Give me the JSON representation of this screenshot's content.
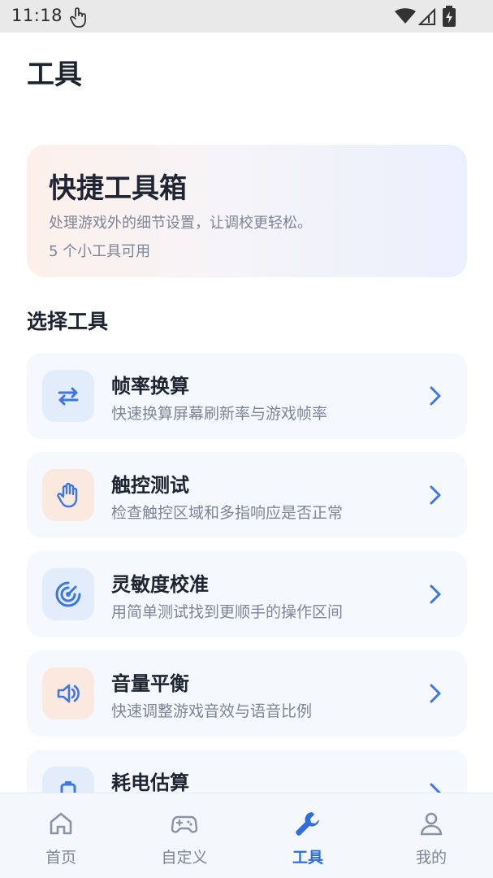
{
  "status_bar": {
    "time": "11:18",
    "icons": [
      "gesture-icon",
      "wifi-icon",
      "signal-icon",
      "battery-charging-icon"
    ]
  },
  "header": {
    "title": "工具"
  },
  "hero": {
    "title": "快捷工具箱",
    "subtitle": "处理游戏外的细节设置，让调校更轻松。",
    "count_text": "5 个小工具可用"
  },
  "section": {
    "title": "选择工具"
  },
  "tools": [
    {
      "title": "帧率换算",
      "description": "快速换算屏幕刷新率与游戏帧率",
      "icon": "swap-arrows-icon",
      "icon_bg": "blue"
    },
    {
      "title": "触控测试",
      "description": "检查触控区域和多指响应是否正常",
      "icon": "hand-icon",
      "icon_bg": "peach"
    },
    {
      "title": "灵敏度校准",
      "description": "用简单测试找到更顺手的操作区间",
      "icon": "target-icon",
      "icon_bg": "blue"
    },
    {
      "title": "音量平衡",
      "description": "快速调整游戏音效与语音比例",
      "icon": "speaker-icon",
      "icon_bg": "peach"
    },
    {
      "title": "耗电估算",
      "description": "",
      "icon": "battery-icon",
      "icon_bg": "blue"
    }
  ],
  "bottom_nav": {
    "items": [
      {
        "label": "首页",
        "icon": "home-icon",
        "active": false
      },
      {
        "label": "自定义",
        "icon": "gamepad-icon",
        "active": false
      },
      {
        "label": "工具",
        "icon": "wrench-icon",
        "active": true
      },
      {
        "label": "我的",
        "icon": "user-icon",
        "active": false
      }
    ]
  },
  "colors": {
    "accent": "#2f6ce0",
    "icon_blue": "#3c78e0",
    "icon_peach_fg": "#3c78e0",
    "card_bg": "#f5f8fd",
    "text_primary": "#1d2430",
    "text_secondary": "#7d8596"
  }
}
